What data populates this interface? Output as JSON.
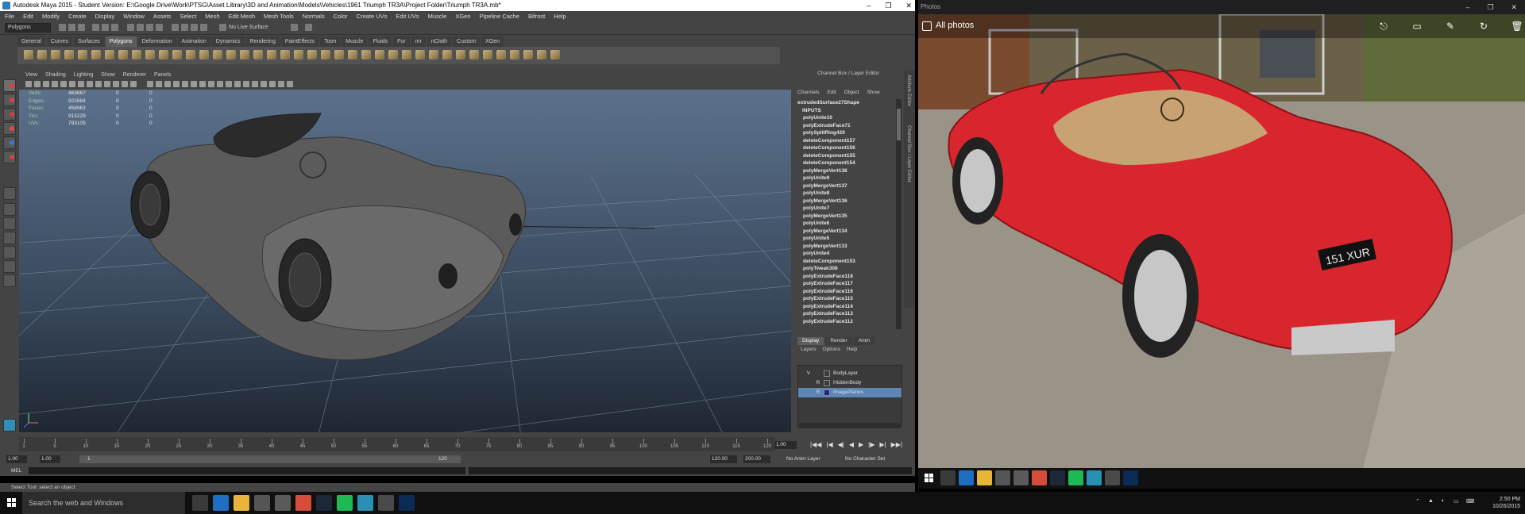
{
  "maya": {
    "title": "Autodesk Maya 2015 - Student Version: E:\\Google Drive\\Work\\PTSG\\Asset Library\\3D and Animation\\Models\\Vehicles\\1961 Triumph TR3A\\Project Folder\\Triumph TR3A.mb*",
    "window_buttons": [
      "–",
      "❐",
      "✕"
    ],
    "menus": [
      "File",
      "Edit",
      "Modify",
      "Create",
      "Display",
      "Window",
      "Assets",
      "Select",
      "Mesh",
      "Edit Mesh",
      "Mesh Tools",
      "Normals",
      "Color",
      "Create UVs",
      "Edit UVs",
      "Muscle",
      "XGen",
      "Pipeline Cache",
      "Bifrost",
      "Help"
    ],
    "mode_menu": "Polygons",
    "live_surface": "No Live Surface",
    "shelf_tabs": [
      "General",
      "Curves",
      "Surfaces",
      "Polygons",
      "Deformation",
      "Animation",
      "Dynamics",
      "Rendering",
      "PaintEffects",
      "Toon",
      "Muscle",
      "Fluids",
      "Fur",
      "mr",
      "nCloth",
      "Custom",
      "XGen"
    ],
    "active_shelf": "Polygons",
    "viewport_menu": [
      "View",
      "Shading",
      "Lighting",
      "Show",
      "Renderer",
      "Panels"
    ],
    "hud": [
      {
        "label": "Verts:",
        "value": "463667",
        "a": "0",
        "b": "0"
      },
      {
        "label": "Edges:",
        "value": "922684",
        "a": "0",
        "b": "0"
      },
      {
        "label": "Faces:",
        "value": "458963",
        "a": "0",
        "b": "0"
      },
      {
        "label": "Tris:",
        "value": "915229",
        "a": "0",
        "b": "0"
      },
      {
        "label": "UVs:",
        "value": "793105",
        "a": "0",
        "b": "0"
      }
    ],
    "channel_box": {
      "title": "Channel Box / Layer Editor",
      "menu": [
        "Channels",
        "Edit",
        "Object",
        "Show"
      ],
      "node": "extrudedSurface27Shape",
      "inputs_label": "INPUTS",
      "inputs": [
        "polyUnite10",
        "polyExtrudeFace71",
        "polySplitRing429",
        "deleteComponent157",
        "deleteComponent156",
        "deleteComponent155",
        "deleteComponent154",
        "polyMergeVert138",
        "polyUnite9",
        "polyMergeVert137",
        "polyUnite8",
        "polyMergeVert136",
        "polyUnite7",
        "polyMergeVert135",
        "polyUnite6",
        "polyMergeVert134",
        "polyUnite5",
        "polyMergeVert133",
        "polyUnite4",
        "deleteComponent153",
        "polyTweak308",
        "polyExtrudeFace118",
        "polyExtrudeFace117",
        "polyExtrudeFace116",
        "polyExtrudeFace115",
        "polyExtrudeFace114",
        "polyExtrudeFace113",
        "polyExtrudeFace112"
      ],
      "side_tabs": [
        "Attribute Editor",
        "Channel Box / Layer Editor"
      ]
    },
    "layer_editor": {
      "tabs": [
        "Display",
        "Render",
        "Anim"
      ],
      "active_tab": "Display",
      "menu": [
        "Layers",
        "Options",
        "Help"
      ],
      "layers": [
        {
          "vis": "V",
          "ref": "",
          "name": "BodyLayer",
          "selected": false
        },
        {
          "vis": "",
          "ref": "R",
          "name": "HiddenBody",
          "selected": false
        },
        {
          "vis": "",
          "ref": "R",
          "name": "ImagePlanes",
          "selected": true
        }
      ]
    },
    "timeline": {
      "ticks": [
        "1",
        "5",
        "10",
        "15",
        "20",
        "25",
        "30",
        "35",
        "40",
        "45",
        "50",
        "55",
        "60",
        "65",
        "70",
        "75",
        "80",
        "85",
        "90",
        "95",
        "100",
        "105",
        "110",
        "115",
        "120"
      ],
      "current_frame": "1.00",
      "play_controls": [
        "|◀◀",
        "|◀",
        "◀|",
        "◀",
        "▶",
        "|▶",
        "▶|",
        "▶▶|"
      ]
    },
    "range": {
      "start": "1.00",
      "playback_start": "1.00",
      "range_start": "1",
      "range_end": "120",
      "playback_end": "120.00",
      "end": "200.00",
      "anim_layer": "No Anim Layer",
      "character_set": "No Character Set"
    },
    "command_line_label": "MEL",
    "help_line": "Select Tool: select an object"
  },
  "photos": {
    "window_title": "Photos",
    "window_buttons": [
      "–",
      "❐",
      "✕"
    ],
    "breadcrumb": "All photos",
    "actions": [
      {
        "icon": "share-icon",
        "glyph": "⎋"
      },
      {
        "icon": "slideshow-icon",
        "glyph": "▭"
      },
      {
        "icon": "edit-icon",
        "glyph": "✎"
      },
      {
        "icon": "rotate-icon",
        "glyph": "↻"
      },
      {
        "icon": "delete-icon",
        "glyph": "🗑"
      }
    ],
    "plate": "151 XUR"
  },
  "taskbar": {
    "search_placeholder": "Search the web and Windows",
    "time": "2:50 PM",
    "date": "10/26/2015",
    "icons": [
      {
        "name": "task-view-icon",
        "color": "#3a3a3a"
      },
      {
        "name": "edge-icon",
        "color": "#1e6fc4"
      },
      {
        "name": "file-explorer-icon",
        "color": "#e8b53a"
      },
      {
        "name": "store-icon",
        "color": "#555555"
      },
      {
        "name": "people-icon",
        "color": "#5a5a5a"
      },
      {
        "name": "chrome-icon",
        "color": "#d64c3a"
      },
      {
        "name": "steam-icon",
        "color": "#1b2838"
      },
      {
        "name": "spotify-icon",
        "color": "#1db954"
      },
      {
        "name": "maya-icon",
        "color": "#2a8fb4"
      },
      {
        "name": "photos-icon",
        "color": "#4a4a4a"
      },
      {
        "name": "photoshop-icon",
        "color": "#0b2a55"
      }
    ]
  }
}
